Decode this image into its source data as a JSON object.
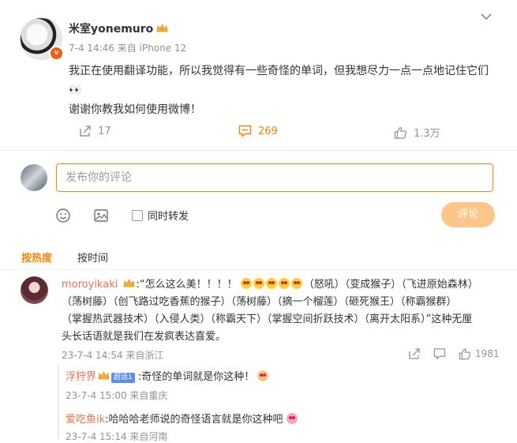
{
  "post": {
    "username": "米室yonemuro",
    "meta": "7-4 14:46  来自 iPhone 12",
    "line1": "我正在使用翻译功能，所以我觉得有一些奇怪的单词，但我想尽力一点一点地记住它们",
    "line1_emoji": "👀",
    "line2": "谢谢你教我如何使用微博！",
    "reposts": "17",
    "comments": "269",
    "likes": "1.3万"
  },
  "composer": {
    "placeholder": "发布你的评论",
    "repost_label": "同时转发",
    "submit_label": "评论"
  },
  "tabs": {
    "hot": "按热度",
    "time": "按时间"
  },
  "comment": {
    "username": "moroyikaki",
    "prefix": ":“怎么这么美！！！！",
    "after_emoji": "（怒吼）（变成猴子）（飞进原始森林）",
    "line2": "（荡树藤）（创飞路过吃香蕉的猴子）（荡树藤）（摘一个榴莲）（砸死猴王）（称霸猴群）",
    "line3": "（掌握热武器技术）（入侵人类）（称霸天下）（掌握空间折跃技术）（离开太阳系）”这种无厘",
    "line4": "头长话语就是我们在发疯表达喜爱。",
    "meta": "23-7-4 14:54  来自浙江",
    "likes": "1981"
  },
  "replies": [
    {
      "username": "浮狩界",
      "level": "超话1",
      "text": ":奇怪的单词就是你这种！",
      "meta": "23-7-4 15:00  来自重庆"
    },
    {
      "username": "爱吃鱼ik",
      "text": ":哈哈哈老师说的奇怪语言就是你这种吧",
      "meta": "23-7-4 15:14  来自河南"
    }
  ]
}
